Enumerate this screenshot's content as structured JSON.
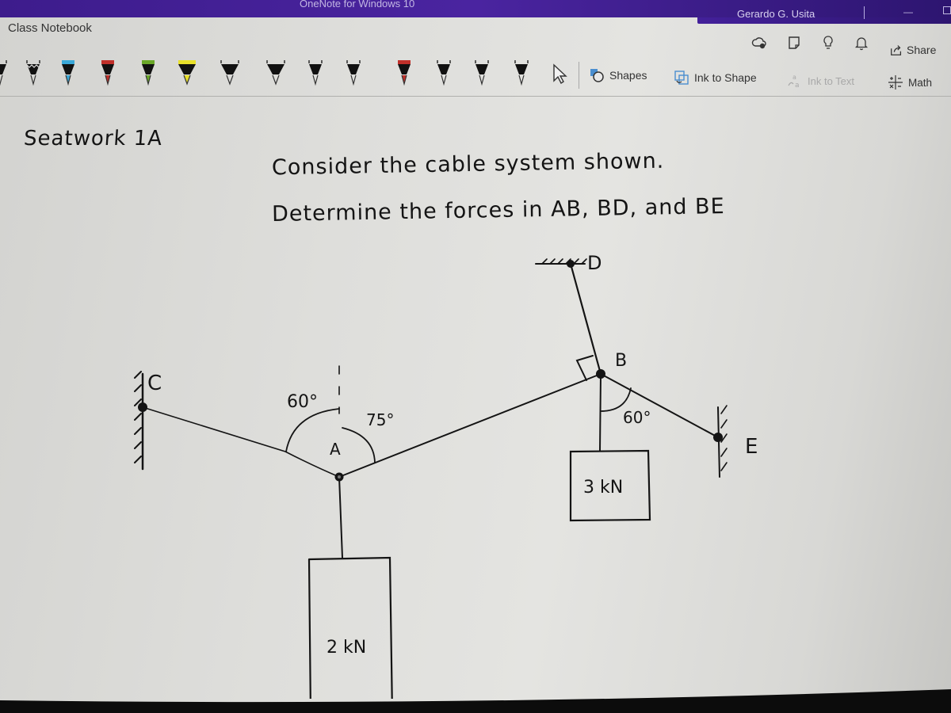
{
  "window": {
    "app_title": "OneNote for Windows 10",
    "user_name": "Gerardo G. Usita",
    "minimize_glyph": "—"
  },
  "ribbon": {
    "notebook_name": "Class Notebook",
    "pens": [
      {
        "name": "pen-black-partial",
        "tip_color": "#111111"
      },
      {
        "name": "pen-black-wavy",
        "tip_color": "#111111"
      },
      {
        "name": "pen-cyan",
        "tip_color": "#3aa8d8"
      },
      {
        "name": "pen-red",
        "tip_color": "#c0302a"
      },
      {
        "name": "pen-green",
        "tip_color": "#6aa828"
      },
      {
        "name": "highlighter-yellow",
        "tip_color": "#e8e02a"
      },
      {
        "name": "pen-black-chisel-1",
        "tip_color": "#111111"
      },
      {
        "name": "pen-black-chisel-2",
        "tip_color": "#111111"
      },
      {
        "name": "pen-black-fine-1",
        "tip_color": "#111111"
      },
      {
        "name": "pen-black-fine-2",
        "tip_color": "#111111"
      },
      {
        "name": "pen-red-fine",
        "tip_color": "#c0302a"
      },
      {
        "name": "pen-black-fine-3",
        "tip_color": "#111111"
      },
      {
        "name": "pen-black-fine-4",
        "tip_color": "#111111"
      },
      {
        "name": "pen-black-fine-5",
        "tip_color": "#111111"
      }
    ],
    "tools": {
      "shapes": "Shapes",
      "ink_to_shape": "Ink to Shape",
      "ink_to_text": "Ink to Text",
      "math": "Math"
    },
    "share_label": "Share"
  },
  "page": {
    "heading": "Seatwork 1A",
    "problem_line1": "Consider the cable system shown.",
    "problem_line2": "Determine the forces in AB, BD, and BE"
  },
  "diagram": {
    "points": {
      "A": "A",
      "B": "B",
      "C": "C",
      "D": "D",
      "E": "E"
    },
    "angles": {
      "A_left": "60°",
      "A_right": "75°",
      "B_bottom": "60°"
    },
    "loads": {
      "A": "2 kN",
      "B": "3 kN"
    }
  },
  "colors": {
    "titlebar": "#3d1c8c",
    "ink": "#141414",
    "paper": "#dededb"
  }
}
